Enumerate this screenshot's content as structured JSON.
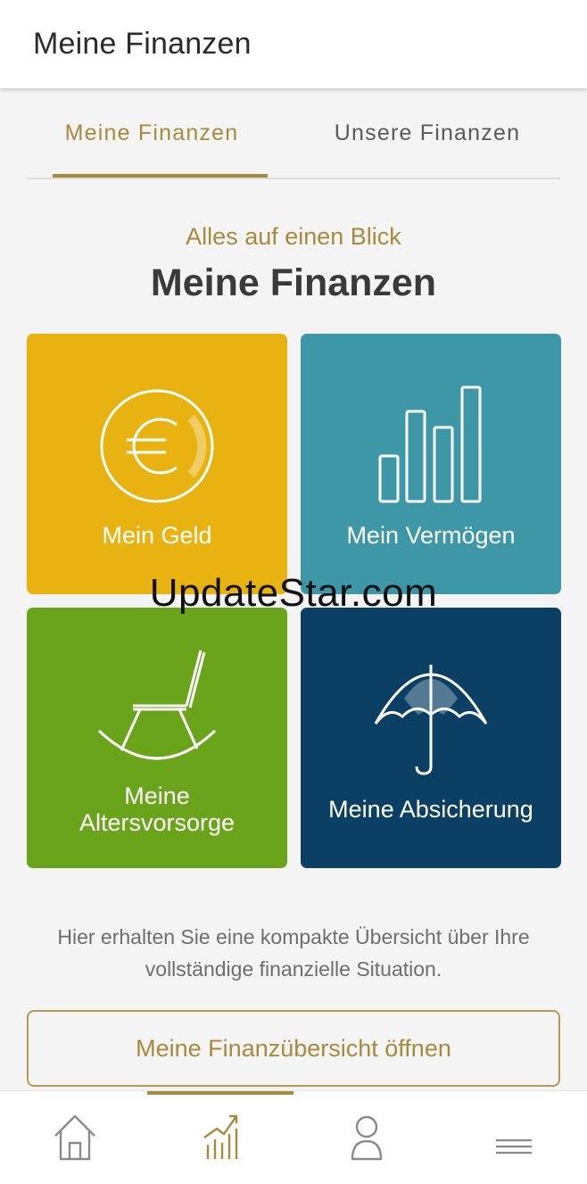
{
  "appbar": {
    "title": "Meine Finanzen"
  },
  "tabs": [
    {
      "label": "Meine Finanzen",
      "active": true
    },
    {
      "label": "Unsere Finanzen",
      "active": false
    }
  ],
  "hero": {
    "subtitle": "Alles auf einen Blick",
    "title": "Meine Finanzen"
  },
  "tiles": [
    {
      "label": "Mein Geld",
      "icon": "euro-coin-icon",
      "color": "#e8b310"
    },
    {
      "label": "Mein Vermögen",
      "icon": "bar-chart-icon",
      "color": "#3d97a6"
    },
    {
      "label_line1": "Meine",
      "label_line2": "Altersvorsorge",
      "icon": "rocking-chair-icon",
      "color": "#6aa41a"
    },
    {
      "label": "Meine Absicherung",
      "icon": "umbrella-icon",
      "color": "#0b4064"
    }
  ],
  "watermark": "UpdateStar.com",
  "description": "Hier erhalten Sie eine kompakte Übersicht über Ihre vollständige finanzielle Situation.",
  "cta": {
    "label": "Meine Finanzübersicht öffnen"
  },
  "bottom_nav": {
    "items": [
      {
        "icon": "home-icon",
        "active": false
      },
      {
        "icon": "chart-icon",
        "active": true
      },
      {
        "icon": "profile-icon",
        "active": false
      },
      {
        "icon": "menu-icon",
        "active": false
      }
    ]
  },
  "colors": {
    "accent": "#a88a3c",
    "background": "#f4f4f4",
    "text_dark": "#3a3a3a"
  }
}
